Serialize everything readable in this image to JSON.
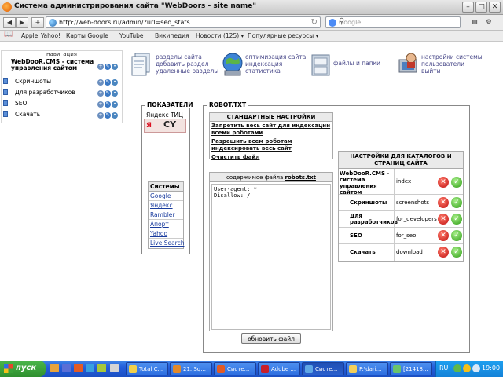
{
  "window": {
    "title": "Система администрирования сайта \"WebDoors - site name\""
  },
  "nav": {
    "url": "http://web-doors.ru/admin/?url=seo_stats",
    "search_placeholder": "Google"
  },
  "bookmarks": [
    "Apple",
    "Yahoo!",
    "Карты Google",
    "YouTube",
    "Википедия",
    "Новости (125) ▾",
    "Популярные ресурсы ▾"
  ],
  "tree": {
    "header": "навигация",
    "items": [
      {
        "label": "WebDooR.CMS - система управления сайтом"
      },
      {
        "label": "Скриншоты"
      },
      {
        "label": "Для разработчиков"
      },
      {
        "label": "SEO"
      },
      {
        "label": "Скачать"
      }
    ]
  },
  "toolbar": [
    {
      "line1": "разделы сайта",
      "line2": "добавить раздел",
      "line3": "удаленные разделы"
    },
    {
      "line1": "оптимизация сайта",
      "line2": "индексация",
      "line3": "статистика"
    },
    {
      "line1": "файлы и папки",
      "line2": "",
      "line3": ""
    },
    {
      "line1": "настройки системы",
      "line2": "пользователи",
      "line3": "выйти"
    }
  ],
  "indicators": {
    "caption": "ПОКАЗАТЕЛИ",
    "tic_label": "Яндекс ТИЦ",
    "badge_y": "Я",
    "badge_cy": "CY",
    "systems_header": "Системы",
    "systems": [
      "Google",
      "Яндекс",
      "Rambler",
      "Апорт",
      "Yahoo",
      "Live Search"
    ]
  },
  "robot": {
    "caption": "ROBOT.TXT",
    "std_header": "СТАНДАРТНЫЕ НАСТРОЙКИ",
    "std_links": [
      "Запретить весь сайт для индексации всеми роботами",
      "Разрешить всем роботам индексировать весь сайт",
      "Очистить файл"
    ],
    "file_header_prefix": "содержимое файла ",
    "file_header_name": "robots.txt",
    "file_content": "User-agent: *\nDisallow: /",
    "update_button": "обновить файл",
    "cat_header": "НАСТРОЙКИ ДЛЯ КАТАЛОГОВ И СТРАНИЦ САЙТА",
    "catalogs": [
      {
        "name": "WebDooR.CMS - система управления сайтом",
        "value": "index"
      },
      {
        "name": "Скриншоты",
        "value": "screenshots"
      },
      {
        "name": "Для разработчиков",
        "value": "for_developers"
      },
      {
        "name": "SEO",
        "value": "for_seo"
      },
      {
        "name": "Скачать",
        "value": "download"
      }
    ]
  },
  "taskbar": {
    "start": "пуск",
    "tasks": [
      "Total C...",
      "21. Sq...",
      "Систе...",
      "Adobe ...",
      "Систе...",
      "F:\\dari...",
      "[21418..."
    ],
    "lang": "RU",
    "clock": "19:00"
  }
}
